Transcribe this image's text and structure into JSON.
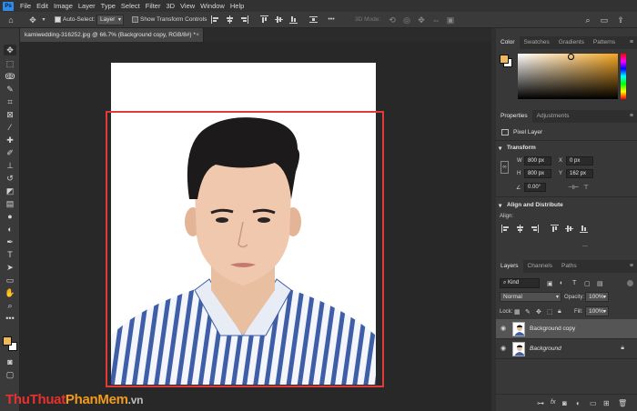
{
  "menu": [
    "File",
    "Edit",
    "Image",
    "Layer",
    "Type",
    "Select",
    "Filter",
    "3D",
    "View",
    "Window",
    "Help"
  ],
  "app_logo": "Ps",
  "options": {
    "auto_select_label": "Auto-Select:",
    "auto_select_checked": true,
    "auto_select_target": "Layer",
    "show_transform_label": "Show Transform Controls",
    "show_transform_checked": false,
    "mode_3d_label": "3D Mode:"
  },
  "document_tab": {
    "title": "kamiwedding-316252.jpg @ 66.7% (Background copy, RGB/8#) *",
    "close": "×"
  },
  "colors": {
    "foreground": "#f0b85c",
    "background": "#ffffff",
    "selection_box": "#e03a3a",
    "accent_blue": "#2d8ceb"
  },
  "color_panel": {
    "tabs": [
      "Color",
      "Swatches",
      "Gradients",
      "Patterns"
    ],
    "active_tab": "Color",
    "hue_color": "#f5a623"
  },
  "properties_panel": {
    "tabs": [
      "Properties",
      "Adjustments"
    ],
    "active_tab": "Properties",
    "layer_kind": "Pixel Layer",
    "transform_title": "Transform",
    "w_label": "W",
    "w_value": "800 px",
    "h_label": "H",
    "h_value": "800 px",
    "x_label": "X",
    "x_value": "0 px",
    "y_label": "Y",
    "y_value": "162 px",
    "angle_value": "0.00°",
    "align_title": "Align and Distribute",
    "align_label": "Align:",
    "more": "..."
  },
  "layers_panel": {
    "tabs": [
      "Layers",
      "Channels",
      "Paths"
    ],
    "active_tab": "Layers",
    "filter_kind": "Kind",
    "blend_mode": "Normal",
    "opacity_label": "Opacity:",
    "opacity_value": "100%",
    "lock_label": "Lock:",
    "fill_label": "Fill:",
    "fill_value": "100%",
    "layers": [
      {
        "name": "Background copy",
        "selected": true,
        "locked": false
      },
      {
        "name": "Background",
        "selected": false,
        "locked": true
      }
    ],
    "footer_icons": [
      "link-icon",
      "fx-icon",
      "mask-icon",
      "adjustment-icon",
      "group-icon",
      "new-layer-icon",
      "trash-icon"
    ]
  },
  "watermark": {
    "part1": "Thu",
    "part2": "Thuat",
    "part3": "PhanMem",
    "part4": ".vn"
  }
}
